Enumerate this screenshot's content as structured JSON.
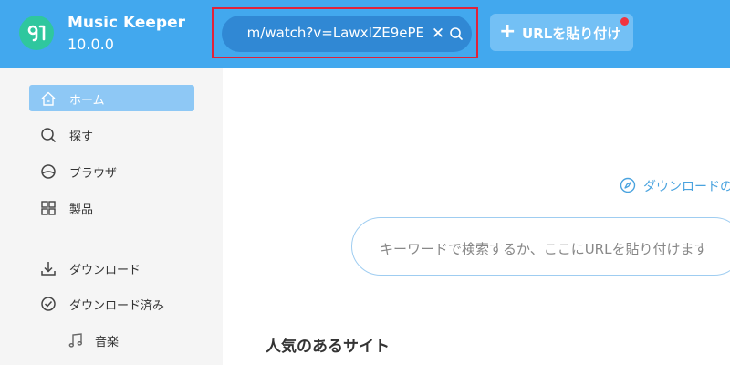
{
  "header": {
    "app_name": "Music Keeper",
    "version": "10.0.0",
    "url_field": {
      "value": "m/watch?v=LawxIZE9ePE",
      "clear_glyph": "✕"
    },
    "paste_button": {
      "icon": "plus-icon",
      "label": "URLを貼り付け"
    }
  },
  "sidebar": {
    "items": [
      {
        "label": "ホーム",
        "icon": "home-icon",
        "active": true
      },
      {
        "label": "探す",
        "icon": "search-icon",
        "active": false
      },
      {
        "label": "ブラウザ",
        "icon": "browser-icon",
        "active": false
      },
      {
        "label": "製品",
        "icon": "grid-icon",
        "active": false
      },
      {
        "label": "ダウンロード",
        "icon": "download-icon",
        "active": false
      },
      {
        "label": "ダウンロード済み",
        "icon": "check-circle-icon",
        "active": false
      },
      {
        "label": "音楽",
        "icon": "music-note-icon",
        "active": false
      }
    ]
  },
  "main": {
    "download_guide": "ダウンロードの",
    "search": {
      "placeholder": "キーワードで検索するか、ここにURLを貼り付けます"
    },
    "popular_title": "人気のあるサイト"
  },
  "colors": {
    "header_bg": "#42a8ee",
    "url_field_bg": "#3088d4",
    "highlight_border": "#e0223a",
    "active_nav_bg": "#8ec8f5",
    "accent": "#4aa3df",
    "logo_bg": "#2fc79e",
    "notification_dot": "#f0333f"
  }
}
